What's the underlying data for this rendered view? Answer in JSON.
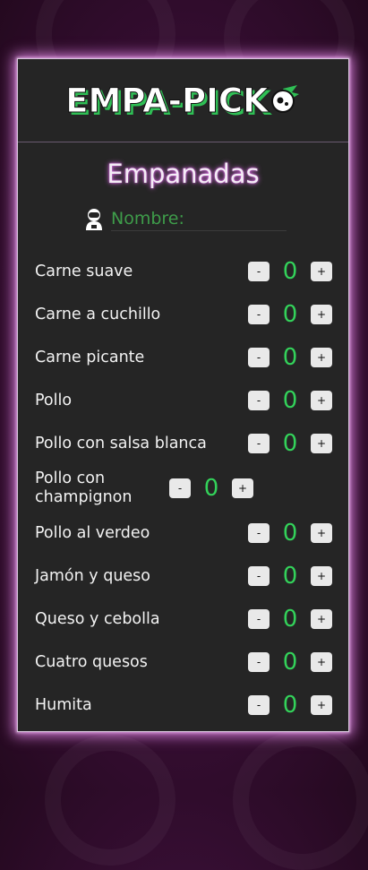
{
  "brand": {
    "logo_text": "EMPA-PICK"
  },
  "header": {
    "title": "Empanadas"
  },
  "name": {
    "placeholder": "Nombre:",
    "value": ""
  },
  "controls": {
    "minus": "-",
    "plus": "+"
  },
  "items": [
    {
      "label": "Carne suave",
      "count": "0"
    },
    {
      "label": "Carne a cuchillo",
      "count": "0"
    },
    {
      "label": "Carne picante",
      "count": "0"
    },
    {
      "label": "Pollo",
      "count": "0"
    },
    {
      "label": "Pollo con salsa blanca",
      "count": "0"
    },
    {
      "label": "Pollo con champignon",
      "count": "0"
    },
    {
      "label": "Pollo al verdeo",
      "count": "0"
    },
    {
      "label": "Jamón y queso",
      "count": "0"
    },
    {
      "label": "Queso y cebolla",
      "count": "0"
    },
    {
      "label": "Cuatro quesos",
      "count": "0"
    },
    {
      "label": "Humita",
      "count": "0"
    }
  ]
}
